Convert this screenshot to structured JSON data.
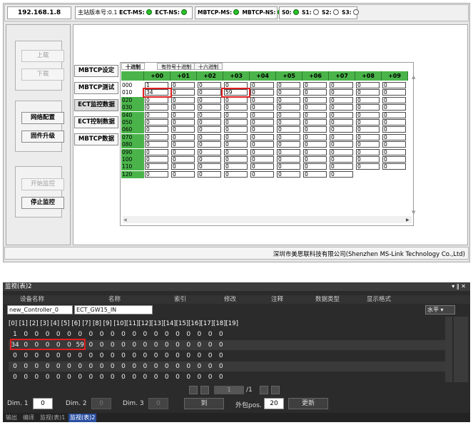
{
  "top": {
    "ip": "192.168.1.8",
    "version": "主站版本号:0.1",
    "ect_ms": "ECT-MS:",
    "ect_ns": "ECT-NS:",
    "mb_ms": "MBTCP-MS:",
    "mb_ns": "MBTCP-NS:",
    "s0": "S0:",
    "s1": "S1:",
    "s2": "S2:",
    "s3": "S3:",
    "left_buttons": {
      "upload": "上载",
      "download": "下载",
      "net_config": "网络配置",
      "firmware": "固件升级",
      "start_mon": "开始监控",
      "stop_mon": "停止监控"
    },
    "tabs": [
      "MBTCP设定",
      "MBTCP测试",
      "ECT监控数据",
      "ECT控制数据",
      "MBTCP数据"
    ],
    "radio": [
      "十进制",
      "有符号十进制",
      "十六进制"
    ],
    "col_headers": [
      "+00",
      "+01",
      "+02",
      "+03",
      "+04",
      "+05",
      "+06",
      "+07",
      "+08",
      "+09"
    ],
    "rows": [
      {
        "label": "000",
        "cells": [
          "1",
          "0",
          "0",
          "0",
          "0",
          "0",
          "0",
          "0",
          "0",
          "0"
        ]
      },
      {
        "label": "010",
        "cells": [
          "34",
          "0",
          "0",
          "59",
          "0",
          "0",
          "0",
          "0",
          "0",
          "0"
        ]
      },
      {
        "label": "020",
        "cells": [
          "0",
          "0",
          "0",
          "0",
          "0",
          "0",
          "0",
          "0",
          "0",
          "0"
        ]
      },
      {
        "label": "030",
        "cells": [
          "0",
          "0",
          "0",
          "0",
          "0",
          "0",
          "0",
          "0",
          "0",
          "0"
        ]
      },
      {
        "label": "040",
        "cells": [
          "0",
          "0",
          "0",
          "0",
          "0",
          "0",
          "0",
          "0",
          "0",
          "0"
        ]
      },
      {
        "label": "050",
        "cells": [
          "0",
          "0",
          "0",
          "0",
          "0",
          "0",
          "0",
          "0",
          "0",
          "0"
        ]
      },
      {
        "label": "060",
        "cells": [
          "0",
          "0",
          "0",
          "0",
          "0",
          "0",
          "0",
          "0",
          "0",
          "0"
        ]
      },
      {
        "label": "070",
        "cells": [
          "0",
          "0",
          "0",
          "0",
          "0",
          "0",
          "0",
          "0",
          "0",
          "0"
        ]
      },
      {
        "label": "080",
        "cells": [
          "0",
          "0",
          "0",
          "0",
          "0",
          "0",
          "0",
          "0",
          "0",
          "0"
        ]
      },
      {
        "label": "090",
        "cells": [
          "0",
          "0",
          "0",
          "0",
          "0",
          "0",
          "0",
          "0",
          "0",
          "0"
        ]
      },
      {
        "label": "100",
        "cells": [
          "0",
          "0",
          "0",
          "0",
          "0",
          "0",
          "0",
          "0",
          "0",
          "0"
        ]
      },
      {
        "label": "110",
        "cells": [
          "0",
          "0",
          "0",
          "0",
          "0",
          "0",
          "0",
          "0",
          "0",
          "0"
        ]
      },
      {
        "label": "120",
        "cells": [
          "0",
          "0",
          "0",
          "0",
          "0",
          "0",
          "0",
          "0"
        ]
      }
    ],
    "footer": "深圳市美思联科技有限公司(Shenzhen MS-Link Technology Co.,Ltd)",
    "colors": {
      "green_header": "#4ab44a",
      "highlight": "#e02020"
    }
  },
  "bottom": {
    "title": "监视(表)2",
    "headers": [
      "设备名称",
      "名称",
      "索引",
      "修改",
      "注释",
      "数据类型",
      "显示格式"
    ],
    "device": "new_Controller_0",
    "name": "ECT_GW15_IN",
    "format": "水平",
    "index_header": "[0] [1] [2] [3] [4] [5] [6] [7] [8] [9] [10][11][12][13][14][15][16][17][18][19]",
    "rows": [
      [
        "1",
        "0",
        "0",
        "0",
        "0",
        "0",
        "0",
        "0",
        "0",
        "0",
        "0",
        "0",
        "0",
        "0",
        "0",
        "0",
        "0",
        "0",
        "0",
        "0"
      ],
      [
        "34",
        "0",
        "0",
        "0",
        "0",
        "0",
        "59",
        "0",
        "0",
        "0",
        "0",
        "0",
        "0",
        "0",
        "0",
        "0",
        "0",
        "0",
        "0",
        "0"
      ],
      [
        "0",
        "0",
        "0",
        "0",
        "0",
        "0",
        "0",
        "0",
        "0",
        "0",
        "0",
        "0",
        "0",
        "0",
        "0",
        "0",
        "0",
        "0",
        "0",
        "0"
      ],
      [
        "0",
        "0",
        "0",
        "0",
        "0",
        "0",
        "0",
        "0",
        "0",
        "0",
        "0",
        "0",
        "0",
        "0",
        "0",
        "0",
        "0",
        "0",
        "0",
        "0"
      ],
      [
        "0",
        "0",
        "0",
        "0",
        "0",
        "0",
        "0",
        "0",
        "0",
        "0",
        "0",
        "0",
        "0",
        "0",
        "0",
        "0",
        "0",
        "0",
        "0",
        "0"
      ]
    ],
    "page": "1",
    "page_total": "/1",
    "dim1_label": "Dim. 1",
    "dim1": "0",
    "dim2_label": "Dim. 2",
    "dim2": "0",
    "dim3_label": "Dim. 3",
    "dim3": "0",
    "goto": "到",
    "outer_pos_label": "外包pos.",
    "outer_pos": "20",
    "update": "更新",
    "tabs": [
      "输出",
      "编译",
      "监视(表)1",
      "监视(表)2"
    ]
  }
}
